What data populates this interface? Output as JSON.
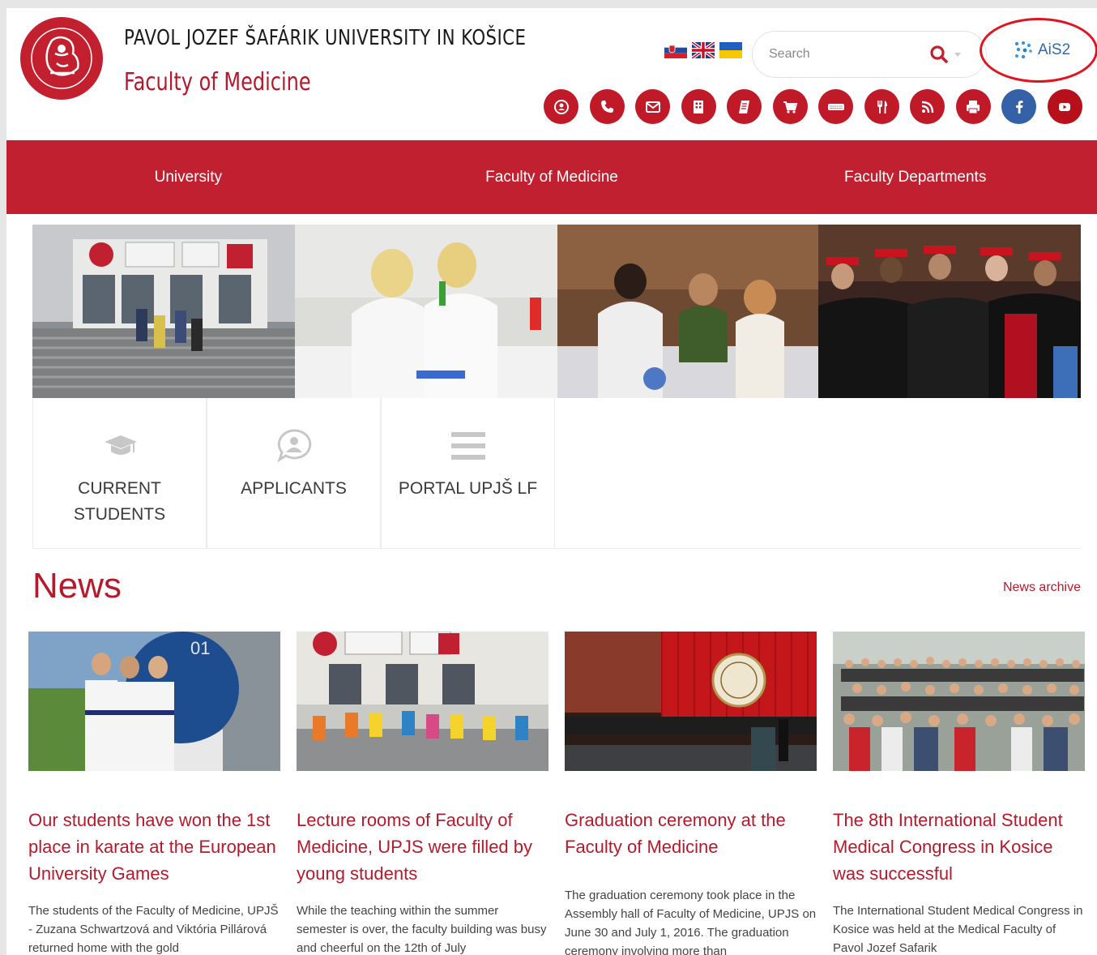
{
  "header": {
    "university_name": "PAVOL JOZEF ŠAFÁRIK UNIVERSITY IN KOŠICE",
    "faculty_name": "Faculty of Medicine",
    "search_placeholder": "Search",
    "ais_label": "AiS2",
    "languages": [
      "slovak-flag",
      "uk-flag",
      "ukraine-flag"
    ],
    "quick_icons": [
      "chat-icon",
      "phone-icon",
      "mail-icon",
      "building-icon",
      "notebook-icon",
      "cart-icon",
      "keyboard-icon",
      "cutlery-icon",
      "rss-icon",
      "print-icon",
      "facebook-icon",
      "youtube-icon"
    ]
  },
  "nav": {
    "items": [
      "University",
      "Faculty of Medicine",
      "Faculty Departments"
    ]
  },
  "quick_links": [
    {
      "label": "CURRENT STUDENTS",
      "icon": "graduation-cap-icon"
    },
    {
      "label": "APPLICANTS",
      "icon": "person-chat-icon"
    },
    {
      "label": "PORTAL UPJŠ LF",
      "icon": "menu-bars-icon"
    }
  ],
  "news": {
    "title": "News",
    "archive_label": "News archive",
    "items": [
      {
        "title": "Our students have won the 1st place in karate at the European University Games",
        "text": "The students of the Faculty of Medicine, UPJŠ - Zuzana Schwartzová and Viktória Pillárová returned home with the gold"
      },
      {
        "title": "Lecture rooms of Faculty of Medicine, UPJS were filled by young students",
        "text": "While the teaching within the summer semester is over, the faculty building was busy and cheerful on the 12th of July"
      },
      {
        "title": "Graduation ceremony at the Faculty of Medicine",
        "text": "The graduation ceremony took place in the Assembly hall of Faculty of Medicine, UPJS on June 30 and July 1, 2016. The graduation ceremony involving more than"
      },
      {
        "title": "The 8th International Student Medical Congress in Kosice was successful",
        "text": "The International Student Medical Congress in Kosice was held at the Medical Faculty of Pavol Jozef Safarik"
      }
    ]
  },
  "colors": {
    "brand_red": "#c0202f",
    "text_red": "#b51a2c",
    "facebook_blue": "#3461a8"
  }
}
